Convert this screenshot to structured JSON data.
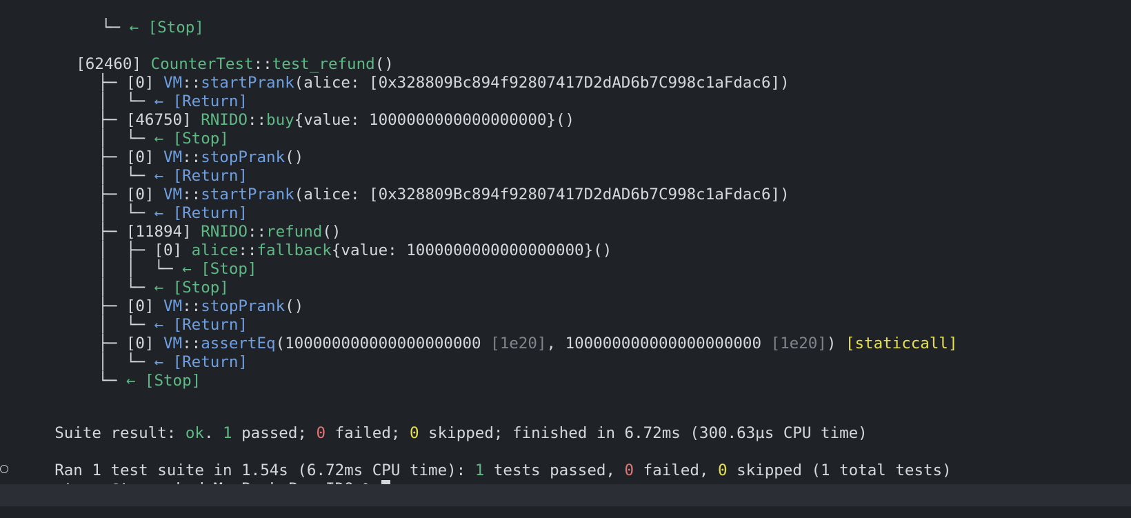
{
  "terminal": {
    "trace": {
      "prev_stop": {
        "tree": "   └─ ",
        "arrow": "← ",
        "status": "[Stop]"
      },
      "test_header": {
        "gas": "[62460]",
        "contract": "CounterTest",
        "sep": "::",
        "fn": "test_refund",
        "args": "()"
      },
      "start_prank_1": {
        "tree": "├─ ",
        "gas": "[0]",
        "contract": "VM",
        "sep": "::",
        "fn": "startPrank",
        "args": "(alice: [0x328809Bc894f92807417D2dAD6b7C998c1aFdac6])"
      },
      "start_prank_1_ret": {
        "tree": "│  └─ ",
        "arrow": "← ",
        "status": "[Return]"
      },
      "buy": {
        "tree": "├─ ",
        "gas": "[46750]",
        "contract": "RNIDO",
        "sep": "::",
        "fn": "buy",
        "args": "{value: 1000000000000000000}()"
      },
      "buy_ret": {
        "tree": "│  └─ ",
        "arrow": "← ",
        "status": "[Stop]"
      },
      "stop_prank_1": {
        "tree": "├─ ",
        "gas": "[0]",
        "contract": "VM",
        "sep": "::",
        "fn": "stopPrank",
        "args": "()"
      },
      "stop_prank_1_ret": {
        "tree": "│  └─ ",
        "arrow": "← ",
        "status": "[Return]"
      },
      "start_prank_2": {
        "tree": "├─ ",
        "gas": "[0]",
        "contract": "VM",
        "sep": "::",
        "fn": "startPrank",
        "args": "(alice: [0x328809Bc894f92807417D2dAD6b7C998c1aFdac6])"
      },
      "start_prank_2_ret": {
        "tree": "│  └─ ",
        "arrow": "← ",
        "status": "[Return]"
      },
      "refund": {
        "tree": "├─ ",
        "gas": "[11894]",
        "contract": "RNIDO",
        "sep": "::",
        "fn": "refund",
        "args": "()"
      },
      "fallback": {
        "tree": "│  ├─ ",
        "gas": "[0]",
        "contract": "alice",
        "sep": "::",
        "fn": "fallback",
        "args": "{value: 1000000000000000000}()"
      },
      "fallback_ret": {
        "tree": "│  │  └─ ",
        "arrow": "← ",
        "status": "[Stop]"
      },
      "refund_ret": {
        "tree": "│  └─ ",
        "arrow": "← ",
        "status": "[Stop]"
      },
      "stop_prank_2": {
        "tree": "├─ ",
        "gas": "[0]",
        "contract": "VM",
        "sep": "::",
        "fn": "stopPrank",
        "args": "()"
      },
      "stop_prank_2_ret": {
        "tree": "│  └─ ",
        "arrow": "← ",
        "status": "[Return]"
      },
      "assert_eq": {
        "tree": "├─ ",
        "gas": "[0]",
        "contract": "VM",
        "sep": "::",
        "fn": "assertEq",
        "open": "(",
        "a": "100000000000000000000",
        "a_hint": "[1e20]",
        "comma": ", ",
        "b": "100000000000000000000",
        "b_hint": "[1e20]",
        "close": ")",
        "tag": "[staticcall]"
      },
      "assert_eq_ret": {
        "tree": "│  └─ ",
        "arrow": "← ",
        "status": "[Return]"
      },
      "final_stop": {
        "tree": "└─ ",
        "arrow": "← ",
        "status": "[Stop]"
      }
    },
    "suite": {
      "label": "Suite result: ",
      "status": "ok",
      "dot": ". ",
      "passed_n": "1",
      "passed_t": " passed; ",
      "failed_n": "0",
      "failed_t": " failed; ",
      "skipped_n": "0",
      "skipped_t": " skipped; finished in 6.72ms (300.63µs CPU time)"
    },
    "ran": {
      "prefix": "Ran 1 test suite in 1.54s (6.72ms CPU time): ",
      "passed_n": "1",
      "passed_t": " tests passed, ",
      "failed_n": "0",
      "failed_t": " failed, ",
      "skipped_n": "0",
      "skipped_t": " skipped (1 total tests)"
    },
    "prompt": {
      "text": "strong@tuwenchudeMacBook-Pro IDO % "
    }
  },
  "colors": {
    "background": "#1f2328",
    "text": "#d4d7dc",
    "green": "#5fb985",
    "blue": "#6f9fe0",
    "red": "#e27575",
    "yellow": "#e7e14f",
    "dim": "#80858d"
  }
}
